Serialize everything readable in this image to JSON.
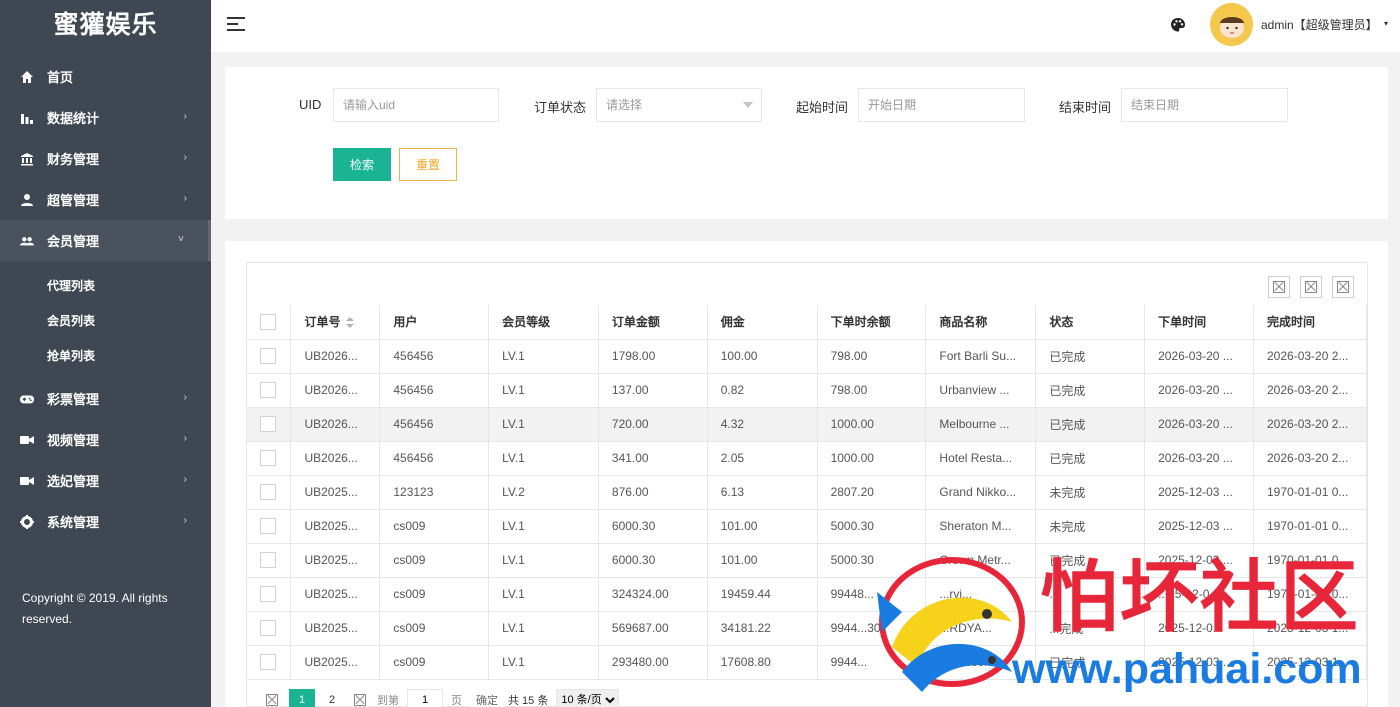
{
  "brand": "蜜獾娱乐",
  "sidebar": {
    "items": [
      {
        "label": "首页",
        "icon": "home-icon",
        "caret": ""
      },
      {
        "label": "数据统计",
        "icon": "bar-chart-icon",
        "caret": "›"
      },
      {
        "label": "财务管理",
        "icon": "bank-icon",
        "caret": "›"
      },
      {
        "label": "超管管理",
        "icon": "user-icon",
        "caret": "›"
      },
      {
        "label": "会员管理",
        "icon": "users-icon",
        "caret": "˅"
      },
      {
        "label": "彩票管理",
        "icon": "gamepad-icon",
        "caret": "›"
      },
      {
        "label": "视频管理",
        "icon": "video-camera-icon",
        "caret": "›"
      },
      {
        "label": "选妃管理",
        "icon": "video-camera-icon",
        "caret": "›"
      },
      {
        "label": "系统管理",
        "icon": "gear-icon",
        "caret": "›"
      }
    ],
    "sub_items": [
      "代理列表",
      "会员列表",
      "抢单列表"
    ],
    "copyright": "Copyright © 2019. All rights reserved."
  },
  "header": {
    "user": "admin【超级管理员】",
    "user_caret": "▾"
  },
  "search": {
    "uid_label": "UID",
    "uid_placeholder": "请输入uid",
    "status_label": "订单状态",
    "status_placeholder": "请选择",
    "start_label": "起始时间",
    "start_placeholder": "开始日期",
    "end_label": "结束时间",
    "end_placeholder": "结束日期",
    "search_btn": "检索",
    "reset_btn": "重置"
  },
  "table": {
    "columns": [
      "订单号",
      "用户",
      "会员等级",
      "订单金额",
      "佣金",
      "下单时余额",
      "商品名称",
      "状态",
      "下单时间",
      "完成时间"
    ],
    "rows": [
      [
        "UB2026...",
        "456456",
        "LV.1",
        "1798.00",
        "100.00",
        "798.00",
        "Fort Barli Su...",
        "已完成",
        "2026-03-20 ...",
        "2026-03-20 2..."
      ],
      [
        "UB2026...",
        "456456",
        "LV.1",
        "137.00",
        "0.82",
        "798.00",
        "Urbanview ...",
        "已完成",
        "2026-03-20 ...",
        "2026-03-20 2..."
      ],
      [
        "UB2026...",
        "456456",
        "LV.1",
        "720.00",
        "4.32",
        "1000.00",
        "Melbourne ...",
        "已完成",
        "2026-03-20 ...",
        "2026-03-20 2..."
      ],
      [
        "UB2026...",
        "456456",
        "LV.1",
        "341.00",
        "2.05",
        "1000.00",
        "Hotel Resta...",
        "已完成",
        "2026-03-20 ...",
        "2026-03-20 2..."
      ],
      [
        "UB2025...",
        "123123",
        "LV.2",
        "876.00",
        "6.13",
        "2807.20",
        "Grand Nikko...",
        "未完成",
        "2025-12-03 ...",
        "1970-01-01 0..."
      ],
      [
        "UB2025...",
        "cs009",
        "LV.1",
        "6000.30",
        "101.00",
        "5000.30",
        "Sheraton M...",
        "未完成",
        "2025-12-03 ...",
        "1970-01-01 0..."
      ],
      [
        "UB2025...",
        "cs009",
        "LV.1",
        "6000.30",
        "101.00",
        "5000.30",
        "Crown Metr...",
        "已完成",
        "2025-12-03 ...",
        "1970-01-01 0..."
      ],
      [
        "UB2025...",
        "cs009",
        "LV.1",
        "324324.00",
        "19459.44",
        "99448...",
        "...rvi...",
        "...",
        "...25-12-0...",
        "1970-01-01 0..."
      ],
      [
        "UB2025...",
        "cs009",
        "LV.1",
        "569687.00",
        "34181.22",
        "9944...30",
        "...RDYA...",
        "...完成",
        "2025-12-0...",
        "2025-12-03 1..."
      ],
      [
        "UB2025...",
        "cs009",
        "LV.1",
        "293480.00",
        "17608.80",
        "9944...",
        "Ho...oser...",
        "已完成",
        "2025-12-03 ...",
        "2025-12-03 1..."
      ]
    ]
  },
  "pager": {
    "page1": "1",
    "page2": "2",
    "goto_label": "到第",
    "goto_value": "1",
    "page_unit": "页",
    "confirm": "确定",
    "total": "共 15 条",
    "per_page": "10 条/页"
  },
  "watermark": {
    "title": "怕坏社区",
    "url": "www.pahuai.com"
  },
  "colors": {
    "sidebar_bg": "#3f4752",
    "accent": "#1ab394",
    "reset": "#f0a422",
    "watermark_red": "#e8263a",
    "watermark_blue": "#1a7be0"
  }
}
